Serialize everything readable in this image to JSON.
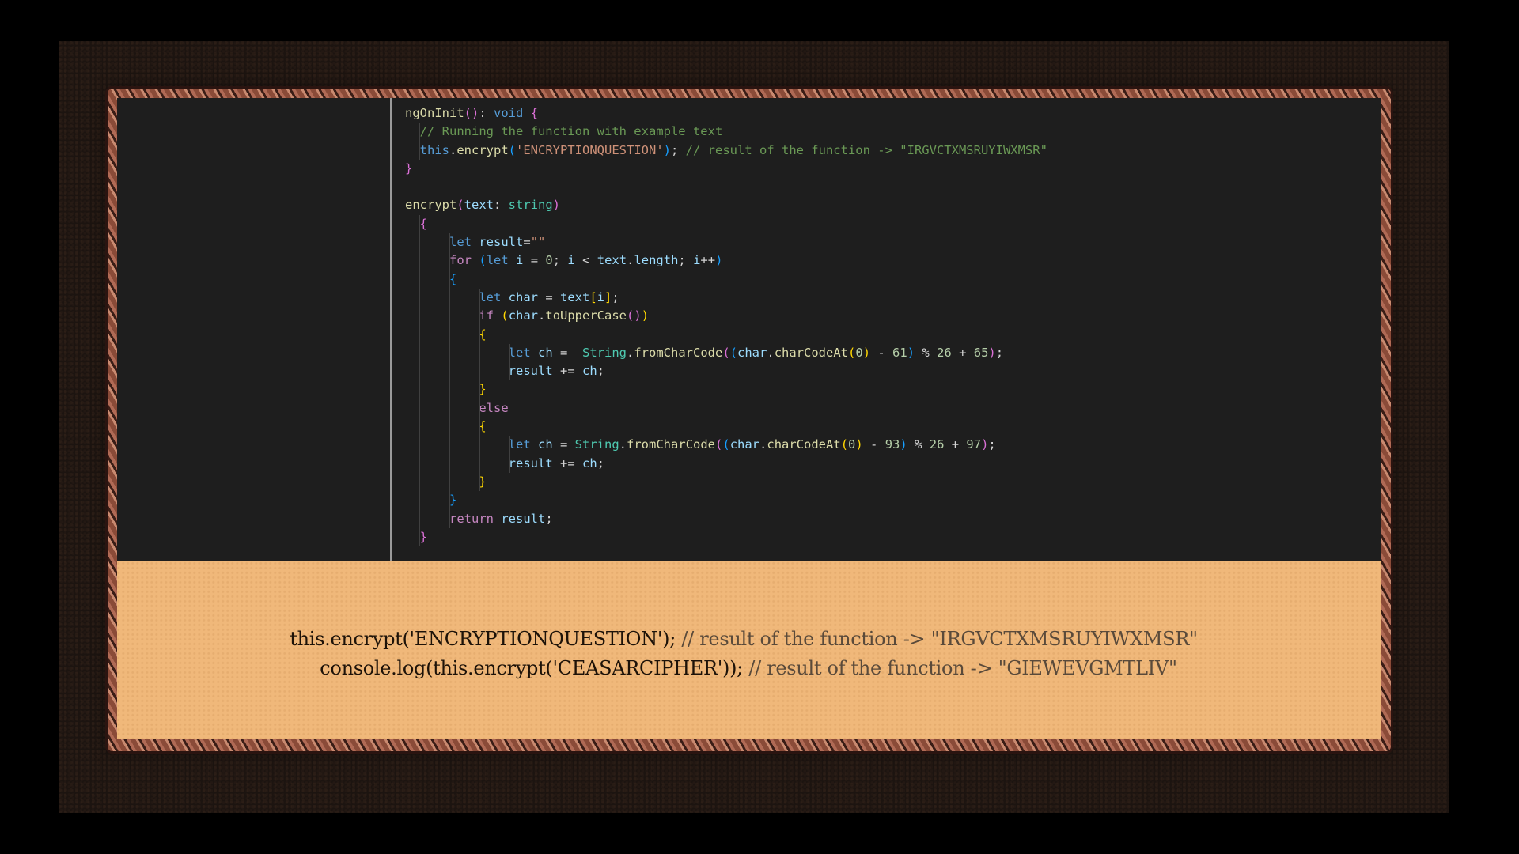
{
  "code": {
    "lines": [
      [
        {
          "t": "ngOnInit",
          "c": "fn"
        },
        {
          "t": "(",
          "c": "p2"
        },
        {
          "t": ")",
          "c": "p2"
        },
        {
          "t": ": ",
          "c": ""
        },
        {
          "t": "void",
          "c": "kw"
        },
        {
          "t": " ",
          "c": ""
        },
        {
          "t": "{",
          "c": "p2"
        }
      ],
      [
        {
          "t": "  ",
          "c": ""
        },
        {
          "t": "// Running the function with example text",
          "c": "com"
        }
      ],
      [
        {
          "t": "  ",
          "c": ""
        },
        {
          "t": "this",
          "c": "kw"
        },
        {
          "t": ".",
          "c": ""
        },
        {
          "t": "encrypt",
          "c": "fn"
        },
        {
          "t": "(",
          "c": "p3"
        },
        {
          "t": "'ENCRYPTIONQUESTION'",
          "c": "str"
        },
        {
          "t": ")",
          "c": "p3"
        },
        {
          "t": "; ",
          "c": ""
        },
        {
          "t": "// result of the function -> \"IRGVCTXMSRUYIWXMSR\"",
          "c": "com"
        }
      ],
      [
        {
          "t": "}",
          "c": "p2"
        }
      ],
      [
        {
          "t": "",
          "c": ""
        }
      ],
      [
        {
          "t": "encrypt",
          "c": "fn"
        },
        {
          "t": "(",
          "c": "p2"
        },
        {
          "t": "text",
          "c": "var"
        },
        {
          "t": ": ",
          "c": ""
        },
        {
          "t": "string",
          "c": "typ"
        },
        {
          "t": ")",
          "c": "p2"
        }
      ],
      [
        {
          "t": "  ",
          "c": ""
        },
        {
          "t": "{",
          "c": "p2"
        }
      ],
      [
        {
          "t": "      ",
          "c": ""
        },
        {
          "t": "let",
          "c": "kw"
        },
        {
          "t": " ",
          "c": ""
        },
        {
          "t": "result",
          "c": "var"
        },
        {
          "t": "=",
          "c": ""
        },
        {
          "t": "\"\"",
          "c": "str"
        }
      ],
      [
        {
          "t": "      ",
          "c": ""
        },
        {
          "t": "for",
          "c": "ctl"
        },
        {
          "t": " ",
          "c": ""
        },
        {
          "t": "(",
          "c": "p3"
        },
        {
          "t": "let",
          "c": "kw"
        },
        {
          "t": " ",
          "c": ""
        },
        {
          "t": "i",
          "c": "var"
        },
        {
          "t": " = ",
          "c": ""
        },
        {
          "t": "0",
          "c": "num"
        },
        {
          "t": "; ",
          "c": ""
        },
        {
          "t": "i",
          "c": "var"
        },
        {
          "t": " < ",
          "c": ""
        },
        {
          "t": "text",
          "c": "var"
        },
        {
          "t": ".",
          "c": ""
        },
        {
          "t": "length",
          "c": "var"
        },
        {
          "t": "; ",
          "c": ""
        },
        {
          "t": "i",
          "c": "var"
        },
        {
          "t": "++",
          "c": ""
        },
        {
          "t": ")",
          "c": "p3"
        }
      ],
      [
        {
          "t": "      ",
          "c": ""
        },
        {
          "t": "{",
          "c": "p3"
        }
      ],
      [
        {
          "t": "          ",
          "c": ""
        },
        {
          "t": "let",
          "c": "kw"
        },
        {
          "t": " ",
          "c": ""
        },
        {
          "t": "char",
          "c": "var"
        },
        {
          "t": " = ",
          "c": ""
        },
        {
          "t": "text",
          "c": "var"
        },
        {
          "t": "[",
          "c": "p1"
        },
        {
          "t": "i",
          "c": "var"
        },
        {
          "t": "]",
          "c": "p1"
        },
        {
          "t": ";",
          "c": ""
        }
      ],
      [
        {
          "t": "          ",
          "c": ""
        },
        {
          "t": "if",
          "c": "ctl"
        },
        {
          "t": " ",
          "c": ""
        },
        {
          "t": "(",
          "c": "p1"
        },
        {
          "t": "char",
          "c": "var"
        },
        {
          "t": ".",
          "c": ""
        },
        {
          "t": "toUpperCase",
          "c": "fn"
        },
        {
          "t": "(",
          "c": "p2"
        },
        {
          "t": ")",
          "c": "p2"
        },
        {
          "t": ")",
          "c": "p1"
        }
      ],
      [
        {
          "t": "          ",
          "c": ""
        },
        {
          "t": "{",
          "c": "p1"
        }
      ],
      [
        {
          "t": "              ",
          "c": ""
        },
        {
          "t": "let",
          "c": "kw"
        },
        {
          "t": " ",
          "c": ""
        },
        {
          "t": "ch",
          "c": "var"
        },
        {
          "t": " =  ",
          "c": ""
        },
        {
          "t": "String",
          "c": "typ"
        },
        {
          "t": ".",
          "c": ""
        },
        {
          "t": "fromCharCode",
          "c": "fn"
        },
        {
          "t": "(",
          "c": "p2"
        },
        {
          "t": "(",
          "c": "p3"
        },
        {
          "t": "char",
          "c": "var"
        },
        {
          "t": ".",
          "c": ""
        },
        {
          "t": "charCodeAt",
          "c": "fn"
        },
        {
          "t": "(",
          "c": "p1"
        },
        {
          "t": "0",
          "c": "num"
        },
        {
          "t": ")",
          "c": "p1"
        },
        {
          "t": " - ",
          "c": ""
        },
        {
          "t": "61",
          "c": "num"
        },
        {
          "t": ")",
          "c": "p3"
        },
        {
          "t": " % ",
          "c": ""
        },
        {
          "t": "26",
          "c": "num"
        },
        {
          "t": " + ",
          "c": ""
        },
        {
          "t": "65",
          "c": "num"
        },
        {
          "t": ")",
          "c": "p2"
        },
        {
          "t": ";",
          "c": ""
        }
      ],
      [
        {
          "t": "              ",
          "c": ""
        },
        {
          "t": "result",
          "c": "var"
        },
        {
          "t": " += ",
          "c": ""
        },
        {
          "t": "ch",
          "c": "var"
        },
        {
          "t": ";",
          "c": ""
        }
      ],
      [
        {
          "t": "          ",
          "c": ""
        },
        {
          "t": "}",
          "c": "p1"
        }
      ],
      [
        {
          "t": "          ",
          "c": ""
        },
        {
          "t": "else",
          "c": "ctl"
        }
      ],
      [
        {
          "t": "          ",
          "c": ""
        },
        {
          "t": "{",
          "c": "p1"
        }
      ],
      [
        {
          "t": "              ",
          "c": ""
        },
        {
          "t": "let",
          "c": "kw"
        },
        {
          "t": " ",
          "c": ""
        },
        {
          "t": "ch",
          "c": "var"
        },
        {
          "t": " = ",
          "c": ""
        },
        {
          "t": "String",
          "c": "typ"
        },
        {
          "t": ".",
          "c": ""
        },
        {
          "t": "fromCharCode",
          "c": "fn"
        },
        {
          "t": "(",
          "c": "p2"
        },
        {
          "t": "(",
          "c": "p3"
        },
        {
          "t": "char",
          "c": "var"
        },
        {
          "t": ".",
          "c": ""
        },
        {
          "t": "charCodeAt",
          "c": "fn"
        },
        {
          "t": "(",
          "c": "p1"
        },
        {
          "t": "0",
          "c": "num"
        },
        {
          "t": ")",
          "c": "p1"
        },
        {
          "t": " - ",
          "c": ""
        },
        {
          "t": "93",
          "c": "num"
        },
        {
          "t": ")",
          "c": "p3"
        },
        {
          "t": " % ",
          "c": ""
        },
        {
          "t": "26",
          "c": "num"
        },
        {
          "t": " + ",
          "c": ""
        },
        {
          "t": "97",
          "c": "num"
        },
        {
          "t": ")",
          "c": "p2"
        },
        {
          "t": ";",
          "c": ""
        }
      ],
      [
        {
          "t": "              ",
          "c": ""
        },
        {
          "t": "result",
          "c": "var"
        },
        {
          "t": " += ",
          "c": ""
        },
        {
          "t": "ch",
          "c": "var"
        },
        {
          "t": ";",
          "c": ""
        }
      ],
      [
        {
          "t": "          ",
          "c": ""
        },
        {
          "t": "}",
          "c": "p1"
        }
      ],
      [
        {
          "t": "      ",
          "c": ""
        },
        {
          "t": "}",
          "c": "p3"
        }
      ],
      [
        {
          "t": "      ",
          "c": ""
        },
        {
          "t": "return",
          "c": "ctl"
        },
        {
          "t": " ",
          "c": ""
        },
        {
          "t": "result",
          "c": "var"
        },
        {
          "t": ";",
          "c": ""
        }
      ],
      [
        {
          "t": "  ",
          "c": ""
        },
        {
          "t": "}",
          "c": "p2"
        }
      ]
    ],
    "guides": [
      [],
      [
        1
      ],
      [
        1
      ],
      [],
      [],
      [],
      [
        1
      ],
      [
        1,
        2
      ],
      [
        1,
        2
      ],
      [
        1,
        2
      ],
      [
        1,
        2,
        3
      ],
      [
        1,
        2,
        3
      ],
      [
        1,
        2,
        3
      ],
      [
        1,
        2,
        3,
        4
      ],
      [
        1,
        2,
        3,
        4
      ],
      [
        1,
        2,
        3
      ],
      [
        1,
        2,
        3
      ],
      [
        1,
        2,
        3
      ],
      [
        1,
        2,
        3,
        4
      ],
      [
        1,
        2,
        3,
        4
      ],
      [
        1,
        2,
        3
      ],
      [
        1,
        2
      ],
      [
        1,
        2
      ],
      [
        1
      ]
    ]
  },
  "caption": {
    "line1_code": "this.encrypt('ENCRYPTIONQUESTION'); ",
    "line1_comment": "// result of the function -> \"IRGVCTXMSRUYIWXMSR\"",
    "line2_code": "console.log(this.encrypt('CEASARCIPHER')); ",
    "line2_comment": "// result of the function -> \"GIEWEVGMTLIV\""
  },
  "colors": {
    "editor_background": "#1e1e1e",
    "caption_background": "#f0b87a",
    "frame": "#b06a55"
  }
}
